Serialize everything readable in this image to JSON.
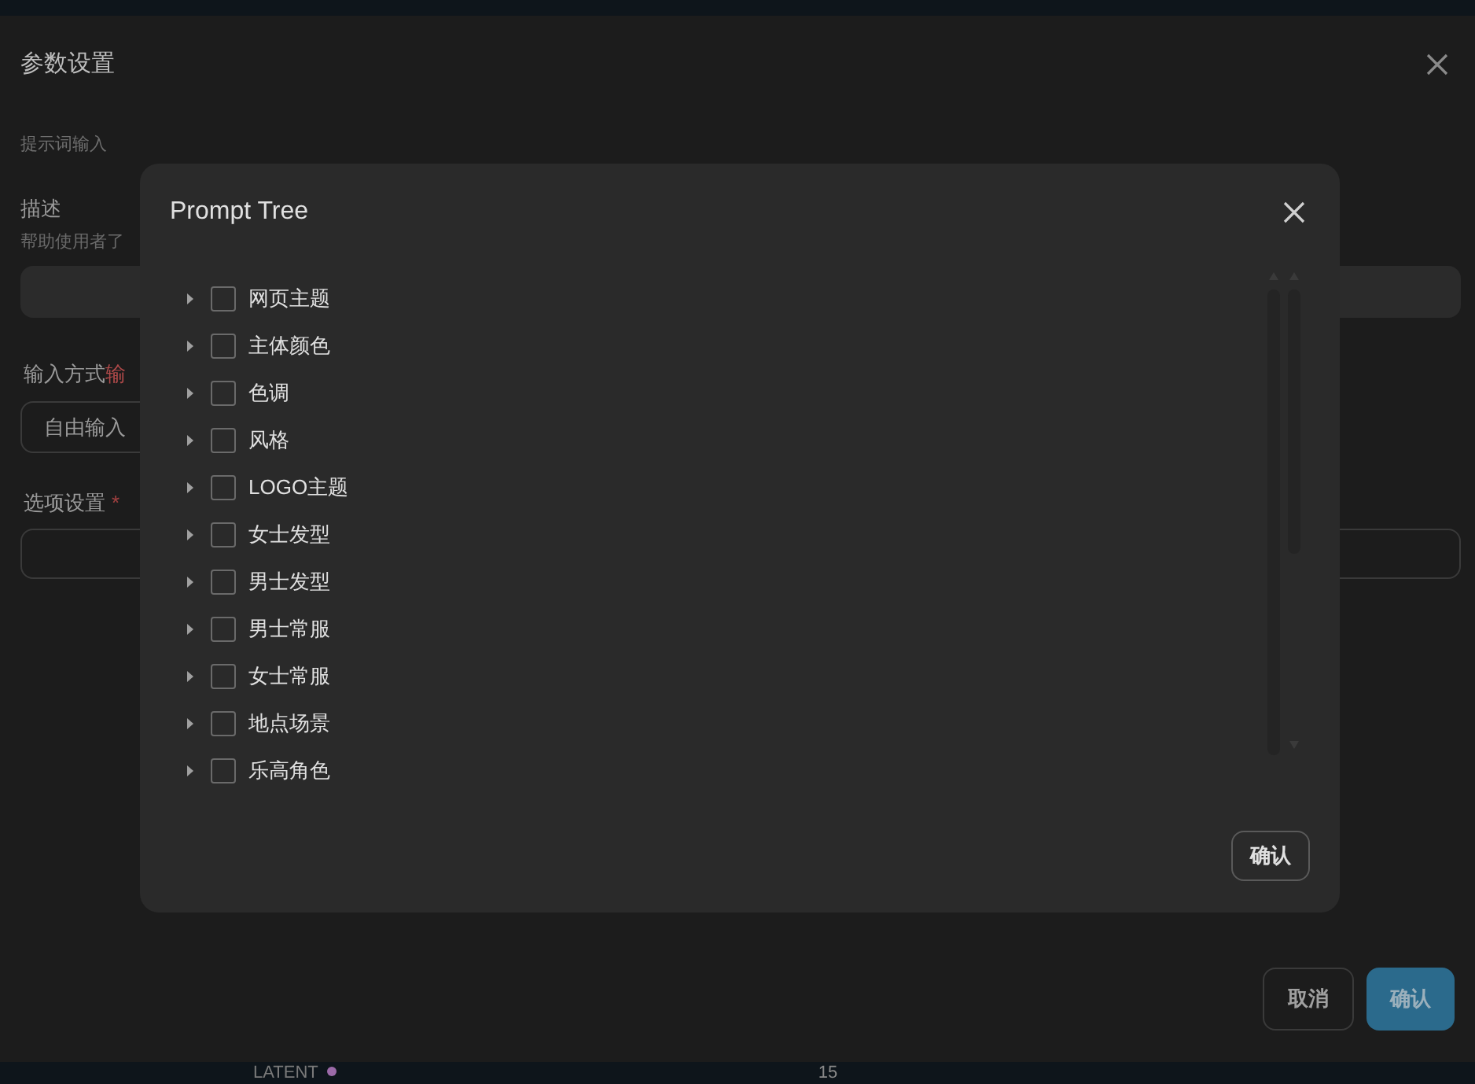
{
  "dialog": {
    "title": "参数设置",
    "section": "提示词输入",
    "description_label": "描述",
    "description_hint": "帮助使用者了",
    "input_mode_label": "输入方式",
    "input_mode_extra": "输",
    "input_mode_button": "自由输入",
    "options_label": "选项设置",
    "options_required": "*",
    "buttons": [
      {
        "label": "取消",
        "kind": "secondary"
      },
      {
        "label": "确认",
        "kind": "primary"
      }
    ]
  },
  "modal": {
    "title": "Prompt Tree",
    "confirm": "确认",
    "items": [
      {
        "label": "网页主题",
        "expanded": false,
        "checked": false
      },
      {
        "label": "主体颜色",
        "expanded": false,
        "checked": false
      },
      {
        "label": "色调",
        "expanded": false,
        "checked": false
      },
      {
        "label": "风格",
        "expanded": false,
        "checked": false
      },
      {
        "label": "LOGO主题",
        "expanded": false,
        "checked": false
      },
      {
        "label": "女士发型",
        "expanded": false,
        "checked": false
      },
      {
        "label": "男士发型",
        "expanded": false,
        "checked": false
      },
      {
        "label": "男士常服",
        "expanded": false,
        "checked": false
      },
      {
        "label": "女士常服",
        "expanded": false,
        "checked": false
      },
      {
        "label": "地点场景",
        "expanded": false,
        "checked": false
      },
      {
        "label": "乐高角色",
        "expanded": false,
        "checked": false
      }
    ]
  },
  "background": {
    "node_label": "LATENT",
    "value": "15"
  }
}
